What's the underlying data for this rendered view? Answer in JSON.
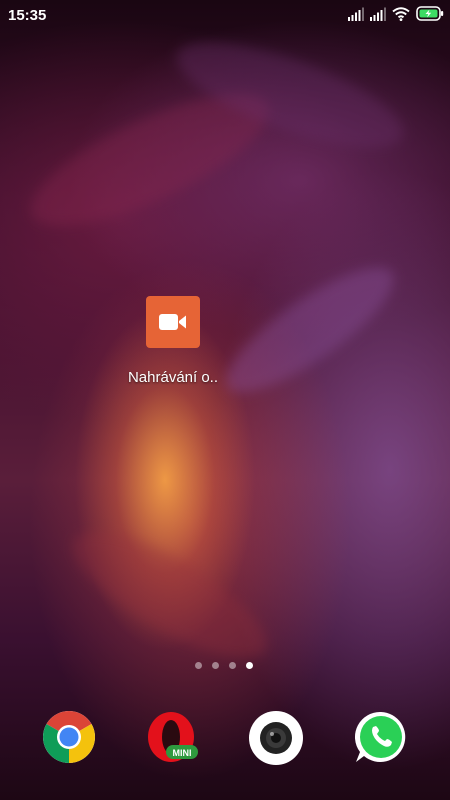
{
  "status_bar": {
    "time": "15:35",
    "icons": [
      "signal-1-icon",
      "signal-2-icon",
      "wifi-icon",
      "battery-charging-icon"
    ]
  },
  "home_screen": {
    "app": {
      "label": "Nahrávání o..",
      "icon": "video-camera-icon",
      "color": "#e66436"
    },
    "page_indicator": {
      "total_pages": 4,
      "active_page": 4
    }
  },
  "dock": {
    "apps": [
      {
        "icon": "chrome-icon"
      },
      {
        "icon": "opera-mini-icon",
        "badge": "MINI"
      },
      {
        "icon": "camera-icon"
      },
      {
        "icon": "whatsapp-icon"
      }
    ]
  },
  "colors": {
    "battery_green": "#3ddc64",
    "whatsapp_green": "#2ad056",
    "opera_red": "#e3111b"
  }
}
